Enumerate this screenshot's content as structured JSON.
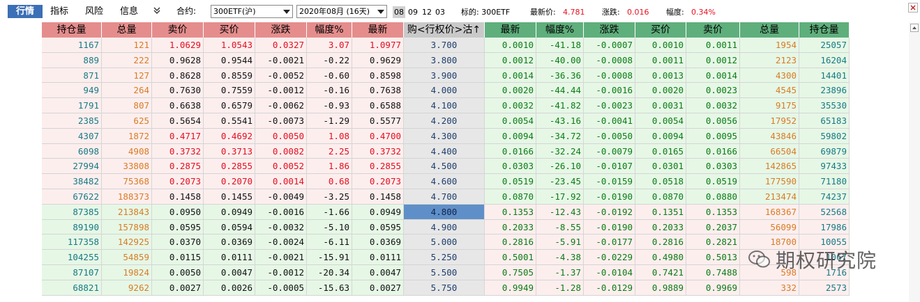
{
  "toolbar": {
    "tabs": [
      "行情",
      "指标",
      "风险",
      "信息"
    ],
    "expand_icon": "double-chevron-down-icon",
    "contract_label": "合约:",
    "contract_value": "300ETF(沪)",
    "expiry_value": "2020年08月 (16天)",
    "expiry_chips": [
      "08",
      "09",
      "12",
      "03"
    ],
    "underlying_label": "标的: 300ETF",
    "last_label": "最新价:",
    "last_value": "4.781",
    "change_label": "涨跌:",
    "change_value": "0.016",
    "pct_label": "幅度:",
    "pct_value": "0.34%"
  },
  "colors": {
    "call_header": "#e58d8d",
    "put_header": "#5faf7c",
    "strike_header": "#c9c9c9",
    "call_bg": "#fdeeee",
    "put_bg": "#e6f7e6",
    "selected_strike": "#5f8fc8"
  },
  "header": {
    "call_columns": [
      "持仓量",
      "总量",
      "卖价",
      "买价",
      "涨跌",
      "幅度%",
      "最新"
    ],
    "strike_column": "购<行权价>沽↑",
    "put_columns": [
      "最新",
      "幅度%",
      "涨跌",
      "买价",
      "卖价",
      "总量",
      "持仓量"
    ]
  },
  "watermark": {
    "text": "期权研究院",
    "icon": "wechat-icon"
  },
  "rows": [
    {
      "call": [
        "1167",
        "121",
        "1.0629",
        "1.0543",
        "0.0327",
        "3.07",
        "1.0977"
      ],
      "strike": "3.700",
      "put": [
        "0.0010",
        "-41.18",
        "-0.0007",
        "0.0010",
        "0.0011",
        "1954",
        "25057"
      ]
    },
    {
      "call": [
        "889",
        "222",
        "0.9628",
        "0.9544",
        "-0.0021",
        "-0.22",
        "0.9629"
      ],
      "strike": "3.800",
      "put": [
        "0.0012",
        "-40.00",
        "-0.0008",
        "0.0011",
        "0.0012",
        "2123",
        "16204"
      ]
    },
    {
      "call": [
        "871",
        "127",
        "0.8628",
        "0.8559",
        "-0.0052",
        "-0.60",
        "0.8598"
      ],
      "strike": "3.900",
      "put": [
        "0.0014",
        "-36.36",
        "-0.0008",
        "0.0013",
        "0.0014",
        "4300",
        "14401"
      ]
    },
    {
      "call": [
        "949",
        "264",
        "0.7630",
        "0.7559",
        "-0.0012",
        "-0.16",
        "0.7638"
      ],
      "strike": "4.000",
      "put": [
        "0.0020",
        "-44.44",
        "-0.0016",
        "0.0020",
        "0.0023",
        "4545",
        "23896"
      ]
    },
    {
      "call": [
        "1791",
        "807",
        "0.6638",
        "0.6579",
        "-0.0062",
        "-0.93",
        "0.6588"
      ],
      "strike": "4.100",
      "put": [
        "0.0032",
        "-41.82",
        "-0.0023",
        "0.0031",
        "0.0032",
        "9175",
        "35530"
      ]
    },
    {
      "call": [
        "2385",
        "625",
        "0.5654",
        "0.5541",
        "-0.0073",
        "-1.29",
        "0.5577"
      ],
      "strike": "4.200",
      "put": [
        "0.0054",
        "-43.16",
        "-0.0041",
        "0.0054",
        "0.0056",
        "17952",
        "65183"
      ]
    },
    {
      "call": [
        "4307",
        "1872",
        "0.4717",
        "0.4692",
        "0.0050",
        "1.08",
        "0.4700"
      ],
      "strike": "4.300",
      "put": [
        "0.0094",
        "-34.72",
        "-0.0050",
        "0.0094",
        "0.0095",
        "43846",
        "59802"
      ]
    },
    {
      "call": [
        "6098",
        "4908",
        "0.3732",
        "0.3713",
        "0.0082",
        "2.25",
        "0.3732"
      ],
      "strike": "4.400",
      "put": [
        "0.0166",
        "-32.24",
        "-0.0079",
        "0.0165",
        "0.0166",
        "66504",
        "69879"
      ]
    },
    {
      "call": [
        "27994",
        "33808",
        "0.2875",
        "0.2855",
        "0.0052",
        "1.86",
        "0.2855"
      ],
      "strike": "4.500",
      "put": [
        "0.0303",
        "-26.10",
        "-0.0107",
        "0.0301",
        "0.0303",
        "142865",
        "97433"
      ]
    },
    {
      "call": [
        "38482",
        "75368",
        "0.2073",
        "0.2070",
        "0.0014",
        "0.68",
        "0.2073"
      ],
      "strike": "4.600",
      "put": [
        "0.0519",
        "-23.45",
        "-0.0159",
        "0.0518",
        "0.0519",
        "177590",
        "71180"
      ]
    },
    {
      "call": [
        "67622",
        "188373",
        "0.1458",
        "0.1455",
        "-0.0049",
        "-3.25",
        "0.1458"
      ],
      "strike": "4.700",
      "put": [
        "0.0870",
        "-17.92",
        "-0.0190",
        "0.0870",
        "0.0880",
        "213474",
        "74237"
      ]
    },
    {
      "call": [
        "87385",
        "213843",
        "0.0950",
        "0.0949",
        "-0.0016",
        "-1.66",
        "0.0949"
      ],
      "strike": "4.800",
      "put": [
        "0.1353",
        "-12.43",
        "-0.0192",
        "0.1351",
        "0.1353",
        "168367",
        "52568"
      ]
    },
    {
      "call": [
        "89190",
        "157898",
        "0.0595",
        "0.0594",
        "-0.0032",
        "-5.10",
        "0.0595"
      ],
      "strike": "4.900",
      "put": [
        "0.2033",
        "-8.55",
        "-0.0190",
        "0.2033",
        "0.2037",
        "56099",
        "17986"
      ]
    },
    {
      "call": [
        "117358",
        "142925",
        "0.0370",
        "0.0369",
        "-0.0024",
        "-6.11",
        "0.0369"
      ],
      "strike": "5.000",
      "put": [
        "0.2816",
        "-5.91",
        "-0.0177",
        "0.2816",
        "0.2821",
        "18700",
        "10055"
      ]
    },
    {
      "call": [
        "104255",
        "54859",
        "0.0115",
        "0.0111",
        "-0.0021",
        "-15.91",
        "0.0111"
      ],
      "strike": "5.250",
      "put": [
        "0.5001",
        "-4.38",
        "-0.0229",
        "0.4980",
        "0.5013",
        "",
        "1067"
      ]
    },
    {
      "call": [
        "87107",
        "19824",
        "0.0050",
        "0.0047",
        "-0.0012",
        "-20.34",
        "0.0047"
      ],
      "strike": "5.500",
      "put": [
        "0.7505",
        "-1.37",
        "-0.0104",
        "0.7421",
        "0.7488",
        "598",
        "1716"
      ]
    },
    {
      "call": [
        "68821",
        "9262",
        "0.0027",
        "0.0026",
        "-0.0005",
        "-15.63",
        "0.0027"
      ],
      "strike": "5.750",
      "put": [
        "0.9949",
        "-1.28",
        "-0.0129",
        "0.9889",
        "0.9969",
        "332",
        "2573"
      ]
    }
  ],
  "selected_strike": "4.800"
}
